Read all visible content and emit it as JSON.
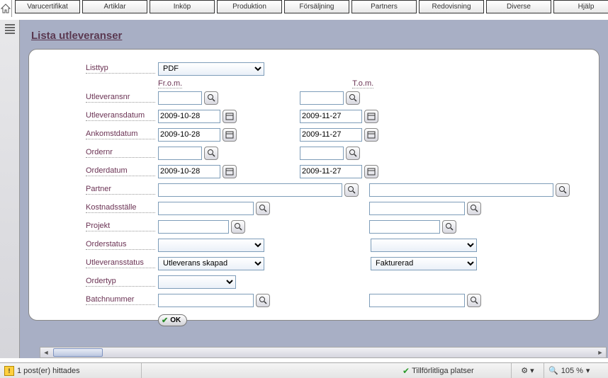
{
  "tabs": [
    "Varucertifikat",
    "Artiklar",
    "Inköp",
    "Produktion",
    "Försäljning",
    "Partners",
    "Redovisning",
    "Diverse",
    "Hjälp"
  ],
  "page_title": "Lista utleveranser",
  "col_from": "Fr.o.m.",
  "col_to": "T.o.m.",
  "labels": {
    "listtyp": "Listtyp",
    "utleveransnr": "Utleveransnr",
    "utleveransdatum": "Utleveransdatum",
    "ankomstdatum": "Ankomstdatum",
    "ordernr": "Ordernr",
    "orderdatum": "Orderdatum",
    "partner": "Partner",
    "kostnadsstalle": "Kostnadsställe",
    "projekt": "Projekt",
    "orderstatus": "Orderstatus",
    "utleveransstatus": "Utleveransstatus",
    "ordertyp": "Ordertyp",
    "batchnummer": "Batchnummer"
  },
  "values": {
    "listtyp": "PDF",
    "utleveransnr_from": "",
    "utleveransnr_to": "",
    "utleveransdatum_from": "2009-10-28",
    "utleveransdatum_to": "2009-11-27",
    "ankomstdatum_from": "2009-10-28",
    "ankomstdatum_to": "2009-11-27",
    "ordernr_from": "",
    "ordernr_to": "",
    "orderdatum_from": "2009-10-28",
    "orderdatum_to": "2009-11-27",
    "partner_from": "",
    "partner_to": "",
    "kostnadsstalle_from": "",
    "kostnadsstalle_to": "",
    "projekt_from": "",
    "projekt_to": "",
    "orderstatus_from": "",
    "orderstatus_to": "",
    "utleveransstatus_from": "Utleverans skapad",
    "utleveransstatus_to": "Fakturerad",
    "ordertyp": "",
    "batchnummer_from": "",
    "batchnummer_to": ""
  },
  "ok_label": "OK",
  "status_left": "1 post(er) hittades",
  "status_trust": "Tillförlitliga platser",
  "status_zoom": "105 %"
}
